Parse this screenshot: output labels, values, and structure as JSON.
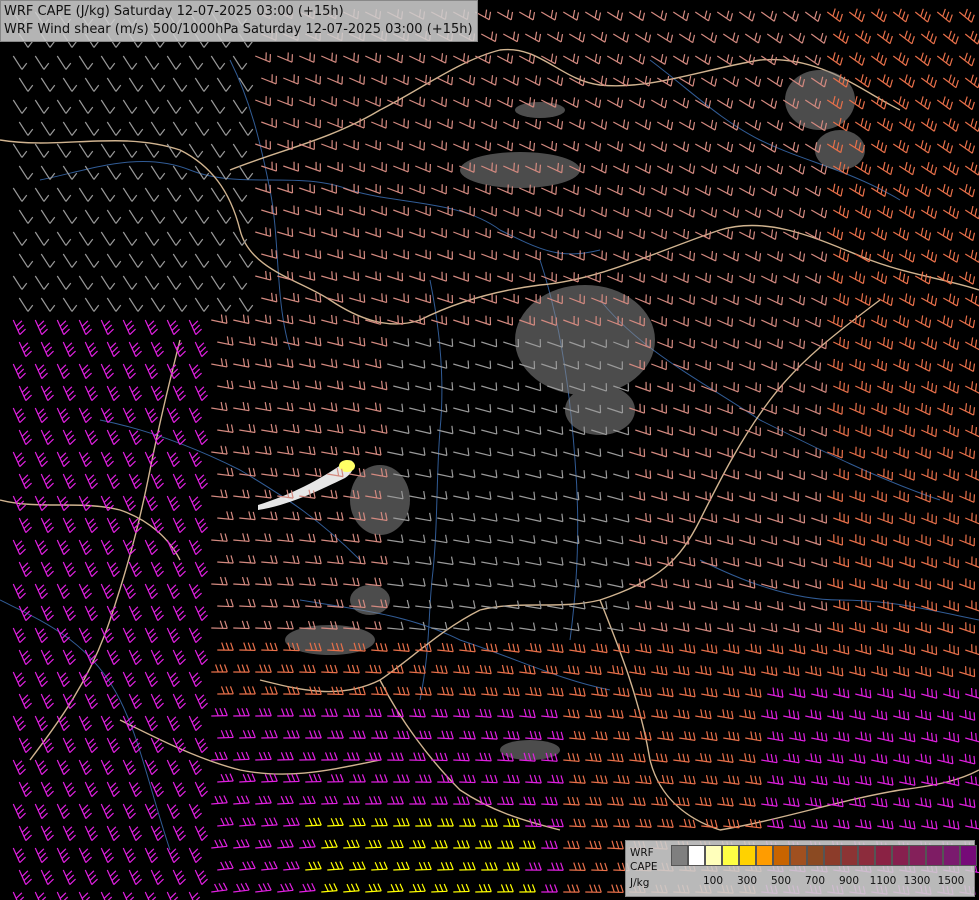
{
  "title": {
    "line1": "WRF CAPE (J/kg) Saturday 12-07-2025 03:00 (+15h)",
    "line2": "WRF Wind shear (m/s) 500/1000hPa Saturday 12-07-2025 03:00 (+15h)"
  },
  "legend": {
    "label_top": "WRF",
    "label_mid": "CAPE",
    "label_unit": "J/kg",
    "colors": [
      "#7f7f7f",
      "#ffffff",
      "#ffffbb",
      "#ffff44",
      "#ffd200",
      "#ff9c00",
      "#c86400",
      "#a05020",
      "#8b4a22",
      "#8c3c2a",
      "#8c3434",
      "#8c2c3c",
      "#8a2244",
      "#86204e",
      "#84205a",
      "#7e1c64",
      "#7a1a6e",
      "#760a78"
    ],
    "ticks": [
      "100",
      "300",
      "500",
      "700",
      "900",
      "1100",
      "1300",
      "1500"
    ]
  },
  "map": {
    "barb_colors": {
      "weak": "#9a9a9a",
      "moderate": "#d48a80",
      "strong": "#e8704a",
      "very_strong": "#e020e0",
      "extreme": "#ffff00"
    },
    "border_color": "#e8c8a0",
    "river_color": "#3a6cb0",
    "cape_highlight_color": "#ffff66"
  }
}
